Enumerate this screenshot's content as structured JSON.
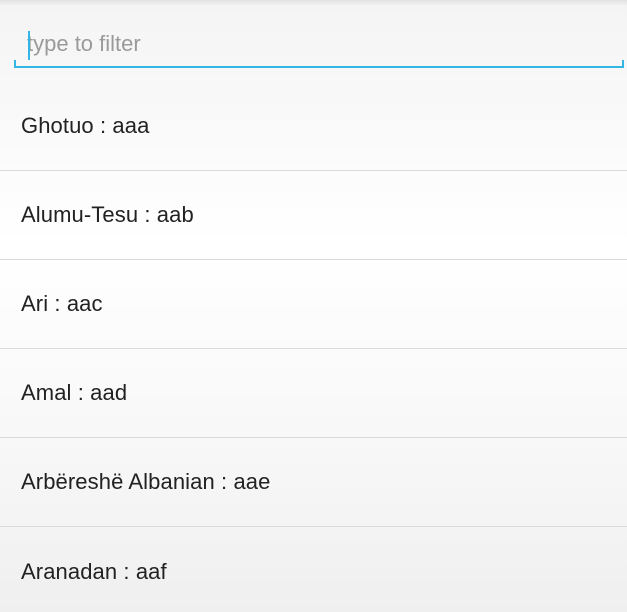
{
  "filter": {
    "placeholder": "type to filter",
    "value": "",
    "accent_color": "#33b5e5"
  },
  "languages": [
    {
      "label": "Ghotuo : aaa"
    },
    {
      "label": "Alumu-Tesu : aab"
    },
    {
      "label": "Ari : aac"
    },
    {
      "label": "Amal : aad"
    },
    {
      "label": "Arbëreshë Albanian : aae"
    },
    {
      "label": "Aranadan : aaf"
    }
  ]
}
